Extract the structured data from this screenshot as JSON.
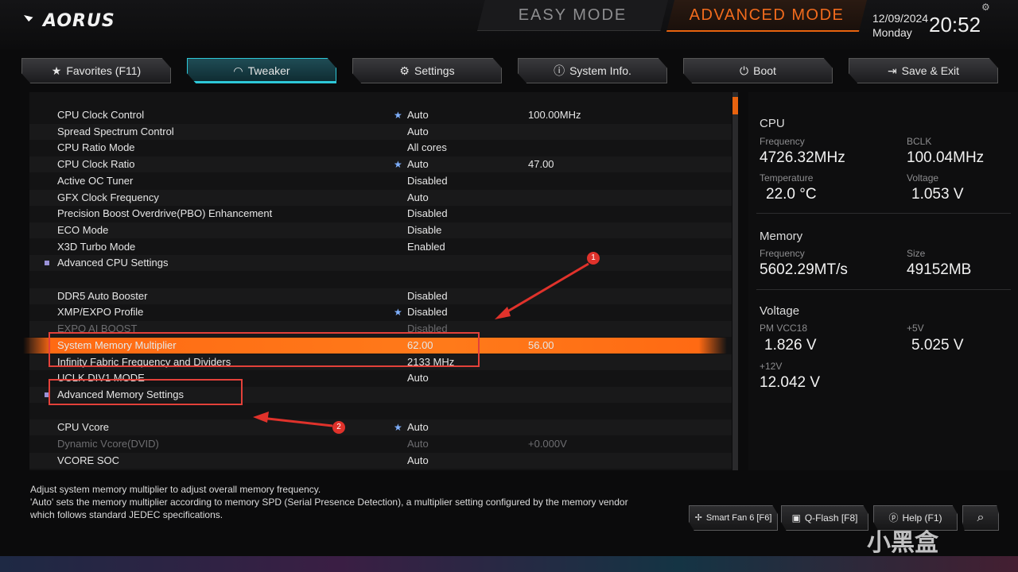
{
  "header": {
    "brand": "AORUS",
    "easy_mode": "EASY MODE",
    "advanced_mode": "ADVANCED MODE",
    "date": "12/09/2024",
    "day": "Monday",
    "time": "20:52",
    "accent_color": "#e8630f"
  },
  "tabs": [
    {
      "label": "Favorites (F11)",
      "icon": "star-icon"
    },
    {
      "label": "Tweaker",
      "icon": "speedometer-icon"
    },
    {
      "label": "Settings",
      "icon": "gear-icon"
    },
    {
      "label": "System Info.",
      "icon": "info-icon"
    },
    {
      "label": "Boot",
      "icon": "power-icon"
    },
    {
      "label": "Save & Exit",
      "icon": "exit-icon"
    }
  ],
  "settings": [
    {
      "label": "CPU Clock Control",
      "value": "Auto",
      "value2": "100.00MHz",
      "star": "★"
    },
    {
      "label": "Spread Spectrum Control",
      "value": "Auto",
      "value2": "",
      "star": ""
    },
    {
      "label": "CPU Ratio Mode",
      "value": "All cores",
      "value2": "",
      "star": ""
    },
    {
      "label": "CPU Clock Ratio",
      "value": "Auto",
      "value2": "47.00",
      "star": "★"
    },
    {
      "label": "Active OC Tuner",
      "value": "Disabled",
      "value2": "",
      "star": ""
    },
    {
      "label": "GFX Clock Frequency",
      "value": "Auto",
      "value2": "",
      "star": ""
    },
    {
      "label": "Precision Boost Overdrive(PBO) Enhancement",
      "value": "Disabled",
      "value2": "",
      "star": ""
    },
    {
      "label": "ECO Mode",
      "value": "Disable",
      "value2": "",
      "star": ""
    },
    {
      "label": "X3D Turbo Mode",
      "value": "Enabled",
      "value2": "",
      "star": ""
    },
    {
      "label": "Advanced CPU Settings",
      "value": "",
      "value2": "",
      "star": "",
      "submenu": true
    },
    {
      "label": "",
      "value": "",
      "value2": "",
      "star": ""
    },
    {
      "label": "DDR5 Auto Booster",
      "value": "Disabled",
      "value2": "",
      "star": ""
    },
    {
      "label": "XMP/EXPO Profile",
      "value": "Disabled",
      "value2": "",
      "star": "★"
    },
    {
      "label": "EXPO AI BOOST",
      "value": "Disabled",
      "value2": "",
      "star": "",
      "dim": true
    },
    {
      "label": "System Memory Multiplier",
      "value": "62.00",
      "value2": "56.00",
      "star": "",
      "selected": true
    },
    {
      "label": "Infinity Fabric Frequency and Dividers",
      "value": "2133 MHz",
      "value2": "",
      "star": ""
    },
    {
      "label": "UCLK DIV1 MODE",
      "value": "Auto",
      "value2": "",
      "star": ""
    },
    {
      "label": "Advanced Memory Settings",
      "value": "",
      "value2": "",
      "star": "",
      "submenu": true
    },
    {
      "label": "",
      "value": "",
      "value2": "",
      "star": ""
    },
    {
      "label": "CPU Vcore",
      "value": "Auto",
      "value2": "",
      "star": "★"
    },
    {
      "label": "Dynamic Vcore(DVID)",
      "value": "Auto",
      "value2": "+0.000V",
      "star": "",
      "dim": true
    },
    {
      "label": "VCORE SOC",
      "value": "Auto",
      "value2": "",
      "star": ""
    }
  ],
  "info": {
    "cpu": {
      "title": "CPU",
      "freq_label": "Frequency",
      "freq": "4726.32MHz",
      "bclk_label": "BCLK",
      "bclk": "100.04MHz",
      "temp_label": "Temperature",
      "temp": "22.0 °C",
      "volt_label": "Voltage",
      "volt": "1.053 V"
    },
    "memory": {
      "title": "Memory",
      "freq_label": "Frequency",
      "freq": "5602.29MT/s",
      "size_label": "Size",
      "size": "49152MB"
    },
    "voltage": {
      "title": "Voltage",
      "pm_label": "PM VCC18",
      "pm": "1.826 V",
      "v5_label": "+5V",
      "v5": "5.025 V",
      "v12_label": "+12V",
      "v12": "12.042 V"
    }
  },
  "help": {
    "line1": "Adjust system memory multiplier to adjust overall memory frequency.",
    "line2": "'Auto' sets the memory multiplier according to memory SPD (Serial Presence Detection), a multiplier setting configured by the memory vendor",
    "line3": "which follows standard JEDEC specifications."
  },
  "bottom_buttons": {
    "smart_fan": "Smart Fan 6 [F6]",
    "qflash": "Q-Flash [F8]",
    "help": "Help (F1)"
  },
  "annotations": {
    "badge1": "1",
    "badge2": "2",
    "color": "#e0322b"
  },
  "watermark": "小黑盒"
}
